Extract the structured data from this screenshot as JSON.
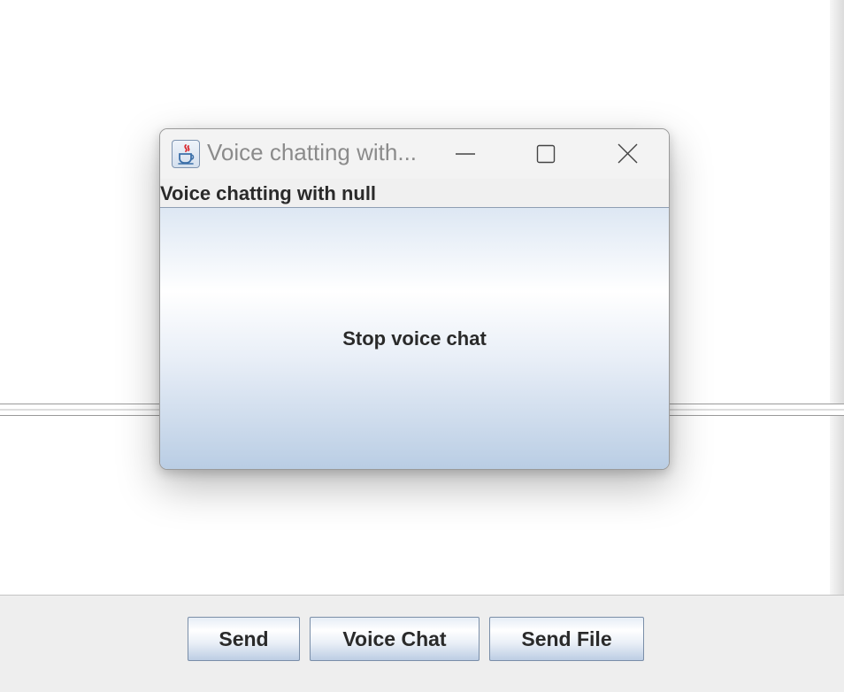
{
  "background_window": {
    "buttons": {
      "send": "Send",
      "voice_chat": "Voice Chat",
      "send_file": "Send File"
    }
  },
  "dialog": {
    "title": "Voice chatting with...",
    "icon": "java-icon",
    "controls": [
      "minimize-icon",
      "maximize-icon",
      "close-icon"
    ],
    "label": "Voice chatting with null",
    "stop_button": "Stop voice chat"
  },
  "colors": {
    "title_text": "#8b8b8b",
    "button_border": "#7a8ea8",
    "button_gradient_bottom": "#bccde4"
  }
}
